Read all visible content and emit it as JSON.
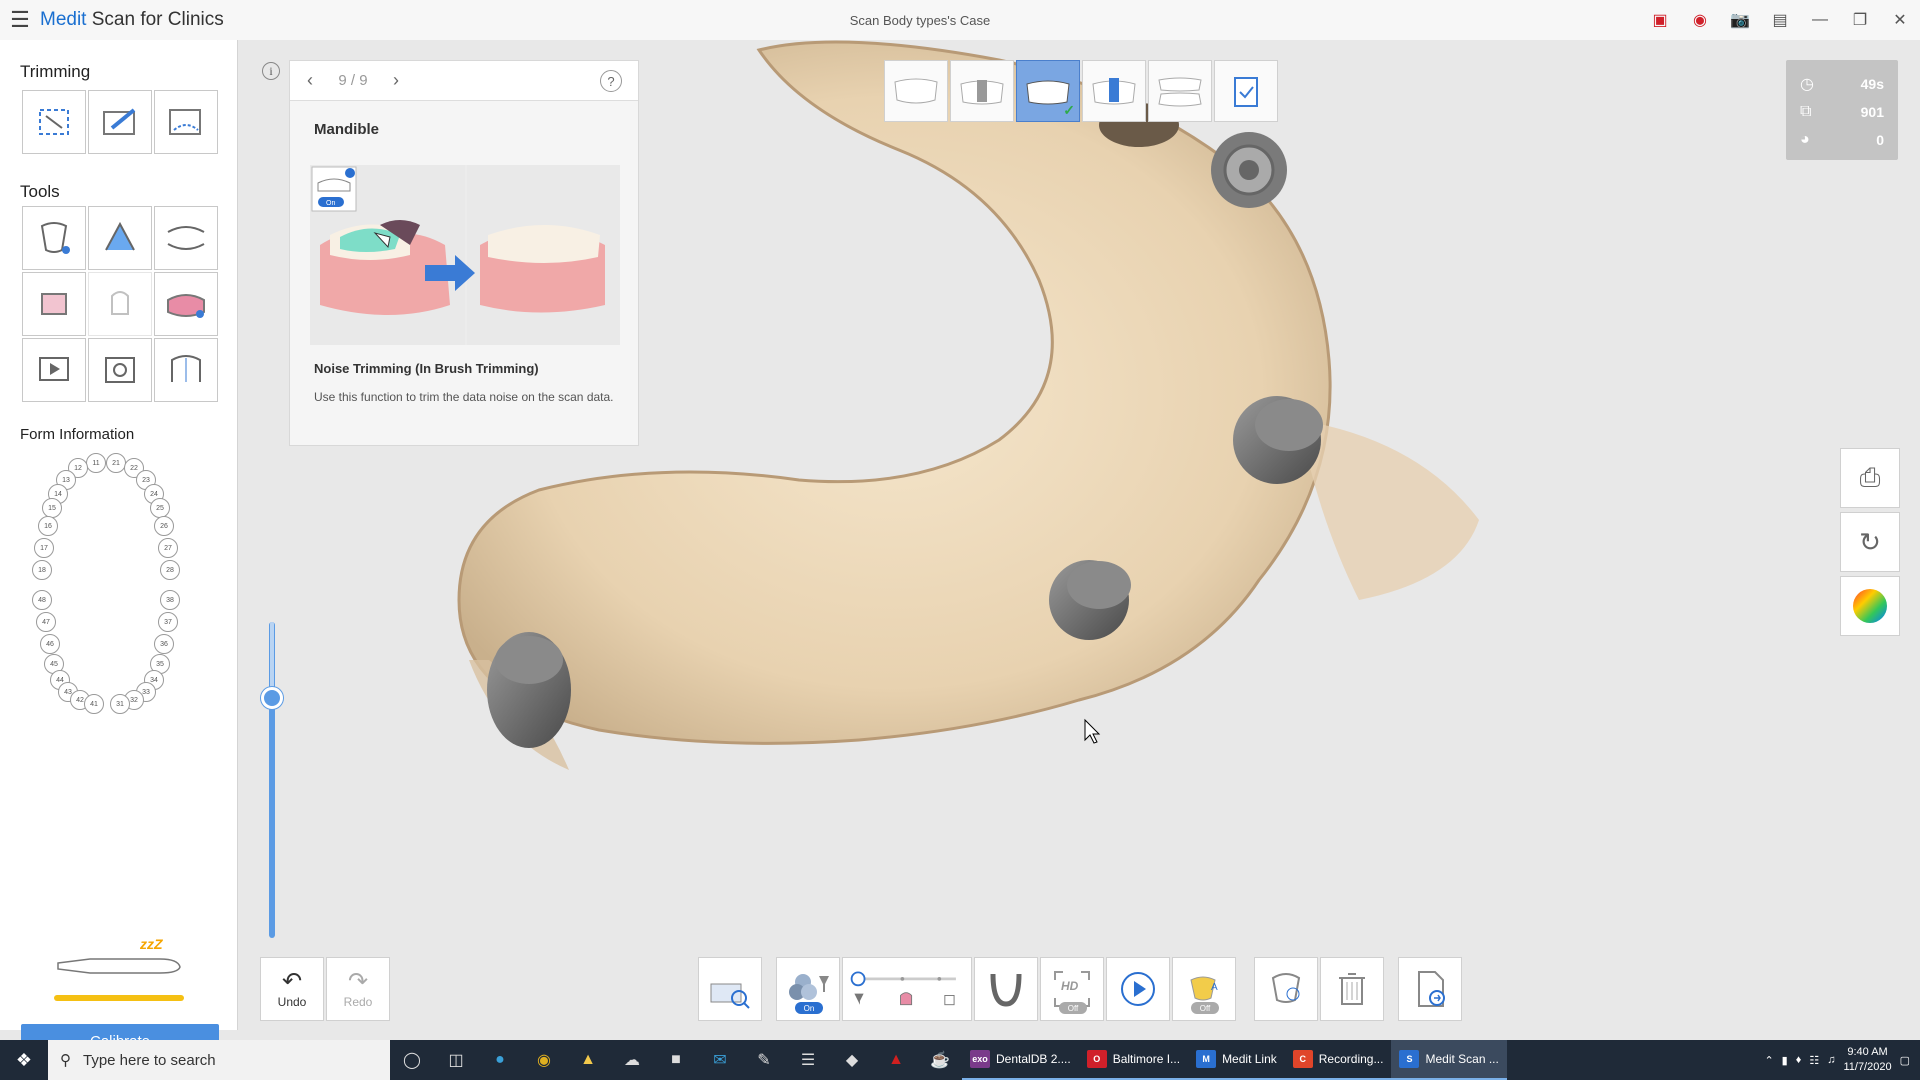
{
  "titlebar": {
    "app_name_brand": "Medit",
    "app_name_rest": " Scan for Clinics",
    "case_title": "Scan Body types's Case"
  },
  "left": {
    "trimming_title": "Trimming",
    "tools_title": "Tools",
    "form_title": "Form Information",
    "calibrate_label": "Calibrate",
    "sleep_label": "zzZ",
    "teeth": [
      {
        "n": "11"
      },
      {
        "n": "21"
      },
      {
        "n": "12"
      },
      {
        "n": "22"
      },
      {
        "n": "13"
      },
      {
        "n": "23"
      },
      {
        "n": "14"
      },
      {
        "n": "24"
      },
      {
        "n": "15"
      },
      {
        "n": "25"
      },
      {
        "n": "16"
      },
      {
        "n": "26"
      },
      {
        "n": "17"
      },
      {
        "n": "27"
      },
      {
        "n": "18"
      },
      {
        "n": "28"
      },
      {
        "n": "48"
      },
      {
        "n": "38"
      },
      {
        "n": "47"
      },
      {
        "n": "37"
      },
      {
        "n": "46"
      },
      {
        "n": "36"
      },
      {
        "n": "45"
      },
      {
        "n": "35"
      },
      {
        "n": "44"
      },
      {
        "n": "34"
      },
      {
        "n": "43"
      },
      {
        "n": "33"
      },
      {
        "n": "42"
      },
      {
        "n": "32"
      },
      {
        "n": "41"
      },
      {
        "n": "31"
      }
    ]
  },
  "tutorial": {
    "info_icon": "i",
    "counter": "9 / 9",
    "help_icon": "?",
    "title": "Mandible",
    "toggle_label": "On",
    "feature_name": "Noise Trimming (In Brush Trimming)",
    "description": "Use this function to trim the data noise on the scan data."
  },
  "stats": {
    "time": "49s",
    "frames": "901",
    "rescan": "0"
  },
  "bottom": {
    "undo_label": "Undo",
    "redo_label": "Redo",
    "on_label": "On",
    "off_label": "Off",
    "hd_label": "HD"
  },
  "taskbar": {
    "search_placeholder": "Type here to search",
    "apps": [
      {
        "label": "DentalDB 2....",
        "badge": "exo",
        "color": "#7a3a8a"
      },
      {
        "label": "Baltimore I...",
        "badge": "O",
        "color": "#d0202a"
      },
      {
        "label": "Medit Link",
        "badge": "M",
        "color": "#2a6fd0"
      },
      {
        "label": "Recording...",
        "badge": "C",
        "color": "#e0452a"
      },
      {
        "label": "Medit Scan ...",
        "badge": "S",
        "color": "#2a6fd0"
      }
    ],
    "time": "9:40 AM",
    "date": "11/7/2020"
  },
  "colors": {
    "accent": "#4a8fe0",
    "calibration_bar": "#f5c013",
    "active_stage": "#7aa6e2"
  }
}
